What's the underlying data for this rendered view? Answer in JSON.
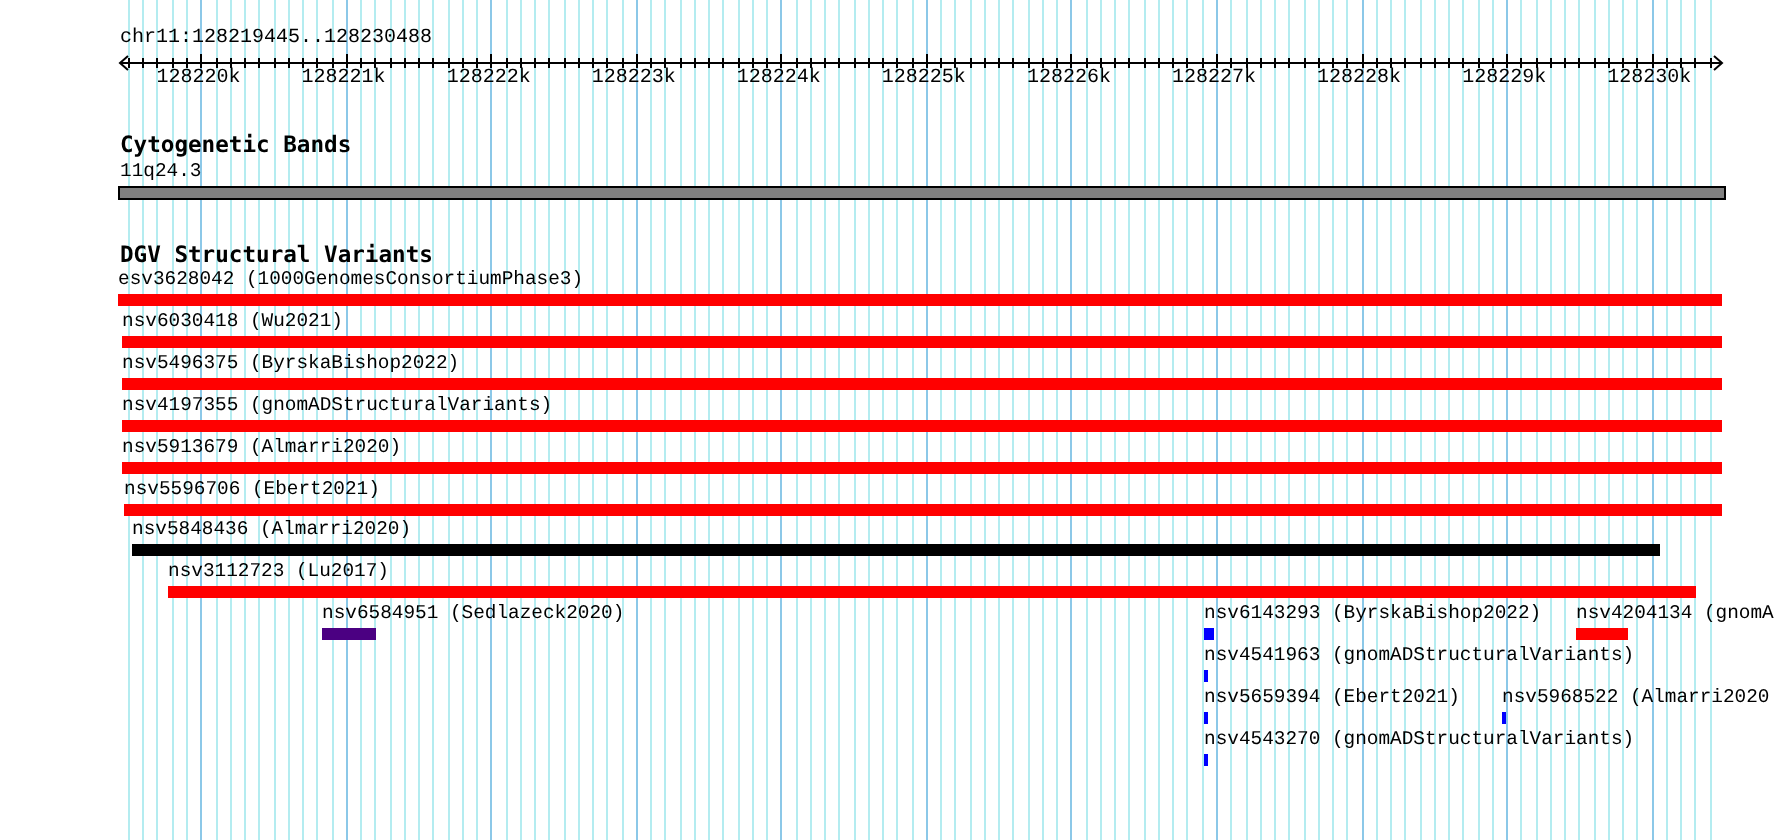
{
  "location": "chr11:128219445..128230488",
  "ruler": {
    "labels": [
      "128220k",
      "128221k",
      "128222k",
      "128223k",
      "128224k",
      "128225k",
      "128226k",
      "128227k",
      "128228k",
      "128229k",
      "128230k"
    ]
  },
  "cytobands": {
    "title": "Cytogenetic Bands",
    "band": "11q24.3"
  },
  "variants": {
    "title": "DGV Structural Variants",
    "features": [
      {
        "label": "esv3628042 (1000GenomesConsortiumPhase3)",
        "color": "#ff0000"
      },
      {
        "label": "nsv6030418 (Wu2021)",
        "color": "#ff0000"
      },
      {
        "label": "nsv5496375 (ByrskaBishop2022)",
        "color": "#ff0000"
      },
      {
        "label": "nsv4197355 (gnomADStructuralVariants)",
        "color": "#ff0000"
      },
      {
        "label": "nsv5913679 (Almarri2020)",
        "color": "#ff0000"
      },
      {
        "label": "nsv5596706 (Ebert2021)",
        "color": "#ff0000"
      },
      {
        "label": "nsv5848436 (Almarri2020)",
        "color": "#000000"
      },
      {
        "label": "nsv3112723 (Lu2017)",
        "color": "#ff0000"
      },
      {
        "label": "nsv6584951 (Sedlazeck2020)",
        "color": "#4b0082"
      },
      {
        "label": "nsv6143293 (ByrskaBishop2022)",
        "color": "#0000ff"
      },
      {
        "label": "nsv4204134 (gnomA",
        "color": "#ff0000"
      },
      {
        "label": "nsv4541963 (gnomADStructuralVariants)",
        "color": "#0000ff"
      },
      {
        "label": "nsv5659394 (Ebert2021)",
        "color": "#0000ff"
      },
      {
        "label": "nsv5968522 (Almarri2020",
        "color": "#0000ff"
      },
      {
        "label": "nsv4543270 (gnomADStructuralVariants)",
        "color": "#0000ff"
      }
    ]
  }
}
